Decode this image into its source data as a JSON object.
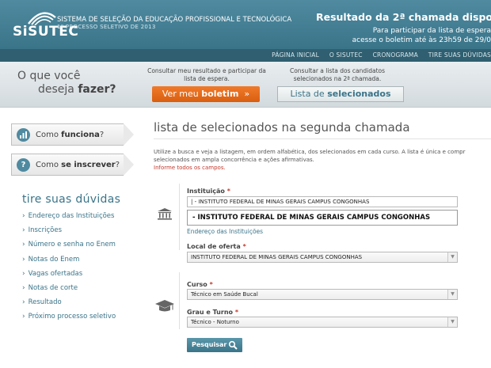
{
  "header": {
    "logo": "SiSUTEC",
    "subtitle1": "SISTEMA DE SELEÇÃO DA EDUCAÇÃO PROFISSIONAL  E TECNOLÓGICA",
    "subtitle2": "1º PROCESSO SELETIVO DE 2013",
    "announce_title": "Resultado da 2ª chamada dispo",
    "announce_line2": "Para participar da lista de espera",
    "announce_line3": "acesse o boletim até às 23h59 de 29/0"
  },
  "nav": {
    "items": [
      "PÁGINA INICIAL",
      "O SISUTEC",
      "CRONOGRAMA",
      "TIRE SUAS DÚVIDAS"
    ]
  },
  "banner": {
    "question_line1": "O que você",
    "question_line2_a": "deseja ",
    "question_line2_b": "fazer?",
    "col1_text": "Consultar meu resultado e participar da lista de espera.",
    "col2_text": "Consultar a lista dos candidatos selecionados na 2ª chamada.",
    "btn_boletim_a": "Ver meu ",
    "btn_boletim_b": "boletim",
    "btn_boletim_arrow": "»",
    "btn_sel_a": "Lista de ",
    "btn_sel_b": "selecionados"
  },
  "sidebar": {
    "btn1_a": "Como ",
    "btn1_b": "funciona",
    "btn1_c": "?",
    "btn2_a": "Como ",
    "btn2_b": "se inscrever",
    "btn2_c": "?",
    "btn2_icon_glyph": "?",
    "duvidas_title": "tire suas dúvidas",
    "chevron": "›",
    "links": [
      "Endereço das Instituições",
      "Inscrições",
      "Número e senha no Enem",
      "Notas do Enem",
      "Vagas ofertadas",
      "Notas de corte",
      "Resultado",
      "Próximo processo seletivo"
    ]
  },
  "main": {
    "title": "lista de selecionados na segunda chamada",
    "desc_line1": "Utilize a busca e veja a listagem, em ordem alfabética, dos selecionados em cada curso. A lista é única e compr",
    "desc_line2": "selecionados em ampla concorrência e ações afirmativas.",
    "warning": "Informe todos os campos.",
    "instituicao_label": "Instituição",
    "required_mark": "*",
    "instituicao_value": "|  - INSTITUTO FEDERAL DE MINAS GERAIS CAMPUS CONGONHAS",
    "suggestion": "- INSTITUTO FEDERAL DE MINAS GERAIS CAMPUS CONGONHAS",
    "enderecos_link": "Endereço das Instituições",
    "local_label": "Local de oferta",
    "local_value": "INSTITUTO FEDERAL DE MINAS GERAIS CAMPUS CONGONHAS",
    "curso_label": "Curso",
    "curso_value": "Técnico em Saúde Bucal",
    "turno_label": "Grau e Turno",
    "turno_value": "Técnico - Noturno",
    "select_arrow": "▼",
    "search_button": "Pesquisar"
  },
  "colors": {
    "header": "#4f8aa0",
    "nav": "#2f5f70",
    "accent_orange": "#e86c1c",
    "link": "#3a7489",
    "warning": "#c0392b"
  },
  "icons": [
    "logo-arc-icon",
    "chart-icon",
    "question-icon",
    "institution-icon",
    "graduation-cap-icon",
    "search-icon"
  ]
}
